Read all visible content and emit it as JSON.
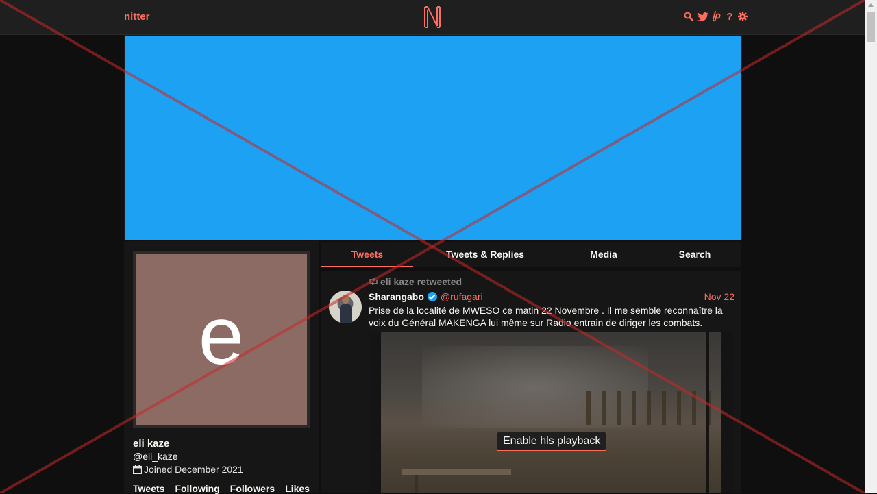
{
  "nav": {
    "brand": "nitter",
    "icons": [
      "search-icon",
      "twitter-icon",
      "liberapay-icon",
      "help-icon",
      "gear-icon"
    ],
    "help_glyph": "?"
  },
  "colors": {
    "accent": "#ff6c60",
    "banner": "#1da1f2",
    "background": "#0f0f0f",
    "card": "#161616"
  },
  "profile": {
    "avatar_letter": "e",
    "fullname": "eli kaze",
    "username": "@eli_kaze",
    "joined": "Joined December 2021",
    "stats": [
      "Tweets",
      "Following",
      "Followers",
      "Likes"
    ]
  },
  "tabs": [
    "Tweets",
    "Tweets & Replies",
    "Media",
    "Search"
  ],
  "tweet": {
    "retweet_text": "eli kaze retweeted",
    "fullname": "Sharangabo",
    "username": "@rufagari",
    "date": "Nov 22",
    "text": "Prise de la localité de MWESO ce matin 22 Novembre . Il me semble reconnaître la voix du Général MAKENGA lui même sur Radio entrain de diriger les combats.",
    "video_button": "Enable hls playback"
  }
}
